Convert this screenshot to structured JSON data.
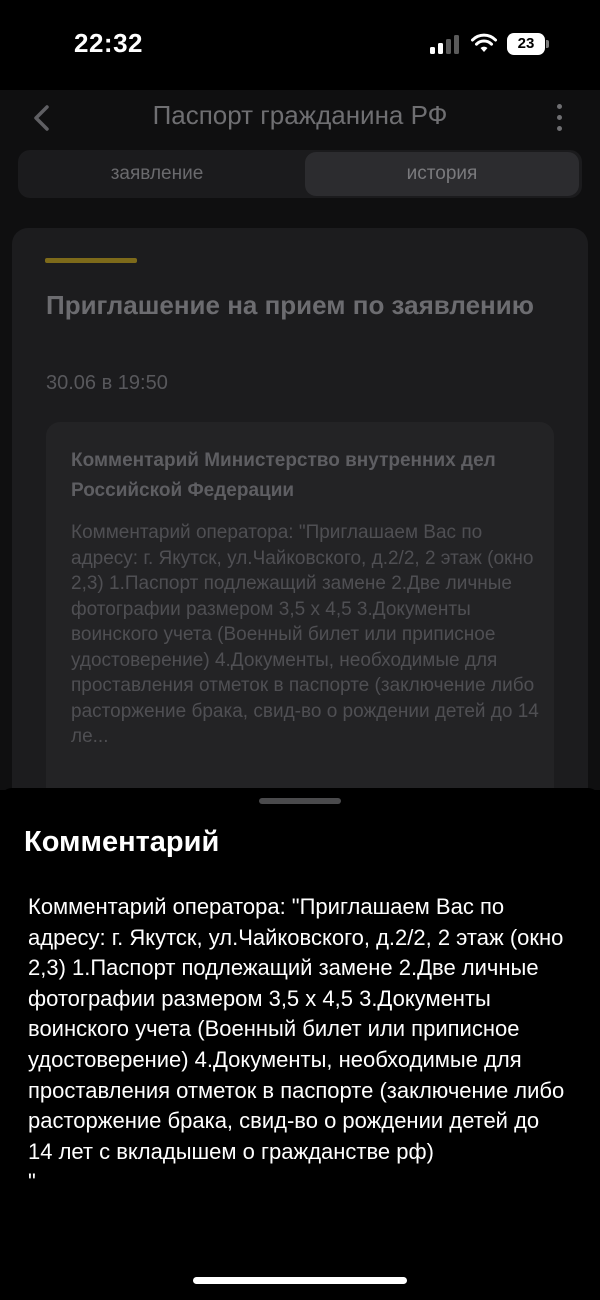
{
  "status_bar": {
    "time": "22:32",
    "battery": "23"
  },
  "nav": {
    "title": "Паспорт гражданина РФ"
  },
  "tabs": [
    {
      "label": "заявление",
      "selected": false
    },
    {
      "label": "история",
      "selected": true
    }
  ],
  "card": {
    "title": "Приглашение на прием по заявлению",
    "date": "30.06 в 19:50",
    "comment_heading": "Комментарий Министерство внутренних дел Российской Федерации",
    "comment_preview": "Комментарий оператора: \"Приглашаем Вас по адресу: г. Якутск, ул.Чайковского, д.2/2, 2 этаж (окно 2,3) 1.Паспорт подлежащий замене 2.Две личные фотографии размером 3,5 х 4,5 3.Документы воинского учета (Военный билет или приписное удостоверение) 4.Документы, необходимые для проставления отметок в паспорте (заключение либо расторжение брака, свид-во о рождении детей до 14 ле..."
  },
  "sheet": {
    "title": "Комментарий",
    "text": "Комментарий оператора: \"Приглашаем Вас по адресу: г. Якутск, ул.Чайковского, д.2/2, 2 этаж (окно 2,3) 1.Паспорт подлежащий замене 2.Две личные фотографии размером 3,5 х 4,5 3.Документы воинского учета (Военный билет или приписное удостоверение) 4.Документы, необходимые для проставления отметок в паспорте (заключение либо расторжение брака, свид-во о рождении детей до 14 лет с вкладышем о гражданстве рф)\n\""
  },
  "icons": {
    "back": "chevron-left-icon",
    "more": "more-vertical-icon",
    "signal": "cellular-signal-icon",
    "wifi": "wifi-icon",
    "battery": "battery-icon"
  },
  "colors": {
    "accent": "#7d6a1a",
    "background": "#000000",
    "card": "#1c1c1e"
  }
}
